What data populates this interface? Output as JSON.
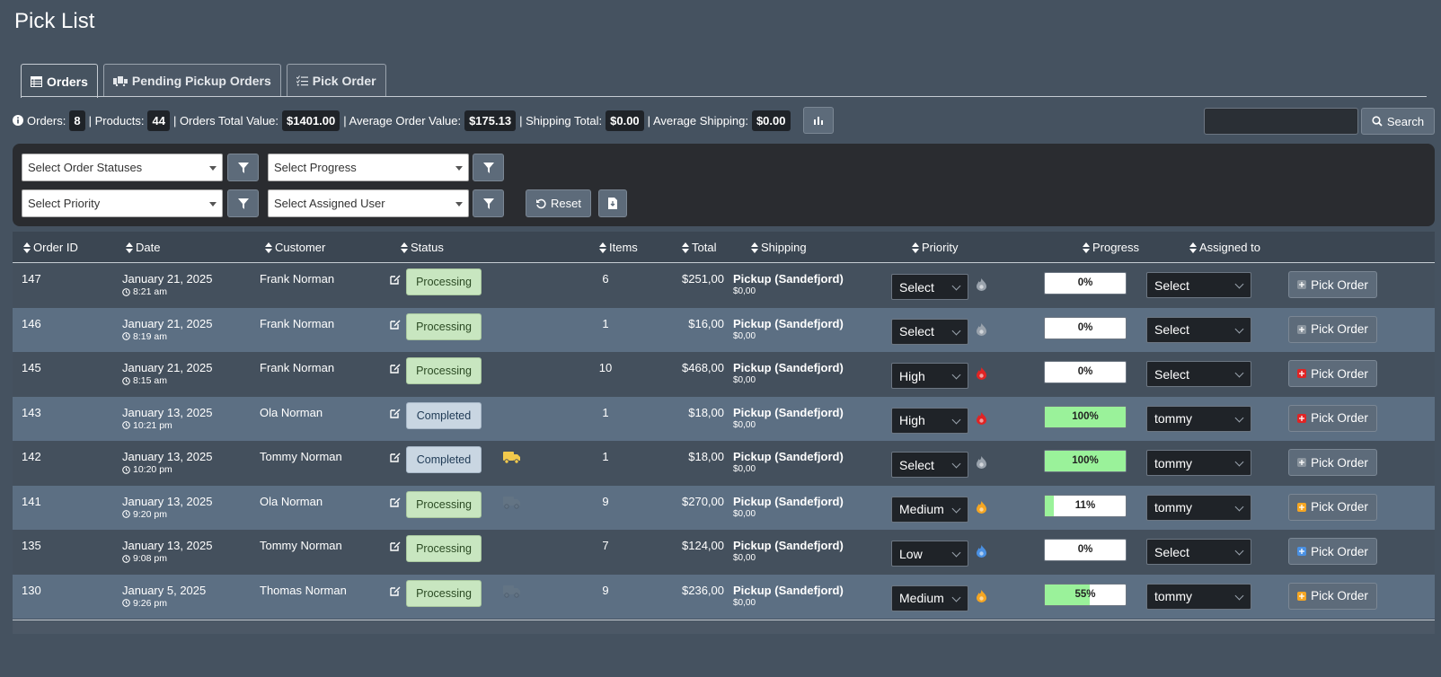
{
  "page": {
    "title": "Pick List"
  },
  "tabs": [
    {
      "label": "Orders",
      "icon": "table-icon",
      "active": true
    },
    {
      "label": "Pending Pickup Orders",
      "icon": "shipping-icon",
      "active": false
    },
    {
      "label": "Pick Order",
      "icon": "checklist-icon",
      "active": false
    }
  ],
  "stats": {
    "orders_label": "Orders:",
    "orders_value": "8",
    "products_label": "| Products:",
    "products_value": "44",
    "total_value_label": "| Orders Total Value:",
    "total_value": "$1401.00",
    "avg_value_label": "| Average Order Value:",
    "avg_value": "$175.13",
    "shipping_total_label": "| Shipping Total:",
    "shipping_total": "$0.00",
    "avg_shipping_label": "| Average Shipping:",
    "avg_shipping": "$0.00"
  },
  "search": {
    "button_label": "Search",
    "value": ""
  },
  "filters": {
    "order_statuses": "Select Order Statuses",
    "progress": "Select Progress",
    "priority": "Select Priority",
    "assigned_user": "Select Assigned User",
    "reset_label": "Reset"
  },
  "table": {
    "headers": [
      "Order ID",
      "Date",
      "Customer",
      "Status",
      "Items",
      "Total",
      "Shipping",
      "Priority",
      "Progress",
      "Assigned to"
    ],
    "pick_label": "Pick Order",
    "rows": [
      {
        "id": "147",
        "date": "January 21, 2025",
        "time": "8:21 am",
        "customer": "Frank Norman",
        "status": "Processing",
        "truck": "",
        "items": "6",
        "total": "$251,00",
        "shipping": "Pickup (Sandefjord)",
        "shipping_cost": "$0,00",
        "priority": "Select",
        "progress": 0,
        "progress_label": "0%",
        "assigned": "Select",
        "pick_color": "#8a949e"
      },
      {
        "id": "146",
        "date": "January 21, 2025",
        "time": "8:19 am",
        "customer": "Frank Norman",
        "status": "Processing",
        "truck": "",
        "items": "1",
        "total": "$16,00",
        "shipping": "Pickup (Sandefjord)",
        "shipping_cost": "$0,00",
        "priority": "Select",
        "progress": 0,
        "progress_label": "0%",
        "assigned": "Select",
        "pick_color": "#8a949e"
      },
      {
        "id": "145",
        "date": "January 21, 2025",
        "time": "8:15 am",
        "customer": "Frank Norman",
        "status": "Processing",
        "truck": "",
        "items": "10",
        "total": "$468,00",
        "shipping": "Pickup (Sandefjord)",
        "shipping_cost": "$0,00",
        "priority": "High",
        "progress": 0,
        "progress_label": "0%",
        "assigned": "Select",
        "pick_color": "#e02424"
      },
      {
        "id": "143",
        "date": "January 13, 2025",
        "time": "10:21 pm",
        "customer": "Ola Norman",
        "status": "Completed",
        "truck": "",
        "items": "1",
        "total": "$18,00",
        "shipping": "Pickup (Sandefjord)",
        "shipping_cost": "$0,00",
        "priority": "High",
        "progress": 100,
        "progress_label": "100%",
        "assigned": "tommy",
        "pick_color": "#e02424"
      },
      {
        "id": "142",
        "date": "January 13, 2025",
        "time": "10:20 pm",
        "customer": "Tommy Norman",
        "status": "Completed",
        "truck": "yellow",
        "items": "1",
        "total": "$18,00",
        "shipping": "Pickup (Sandefjord)",
        "shipping_cost": "$0,00",
        "priority": "Select",
        "progress": 100,
        "progress_label": "100%",
        "assigned": "tommy",
        "pick_color": "#8a949e"
      },
      {
        "id": "141",
        "date": "January 13, 2025",
        "time": "9:20 pm",
        "customer": "Ola Norman",
        "status": "Processing",
        "truck": "faded",
        "items": "9",
        "total": "$270,00",
        "shipping": "Pickup (Sandefjord)",
        "shipping_cost": "$0,00",
        "priority": "Medium",
        "progress": 11,
        "progress_label": "11%",
        "assigned": "tommy",
        "pick_color": "#f5a623"
      },
      {
        "id": "135",
        "date": "January 13, 2025",
        "time": "9:08 pm",
        "customer": "Tommy Norman",
        "status": "Processing",
        "truck": "",
        "items": "7",
        "total": "$124,00",
        "shipping": "Pickup (Sandefjord)",
        "shipping_cost": "$0,00",
        "priority": "Low",
        "progress": 0,
        "progress_label": "0%",
        "assigned": "Select",
        "pick_color": "#4a90e2"
      },
      {
        "id": "130",
        "date": "January 5, 2025",
        "time": "9:26 pm",
        "customer": "Thomas Norman",
        "status": "Processing",
        "truck": "faded",
        "items": "9",
        "total": "$236,00",
        "shipping": "Pickup (Sandefjord)",
        "shipping_cost": "$0,00",
        "priority": "Medium",
        "progress": 55,
        "progress_label": "55%",
        "assigned": "tommy",
        "pick_color": "#f5a623"
      }
    ]
  },
  "colors": {
    "High": "#e02424",
    "Medium": "#f5a623",
    "Low": "#4a90e2",
    "Select": "#9aa3ad"
  }
}
